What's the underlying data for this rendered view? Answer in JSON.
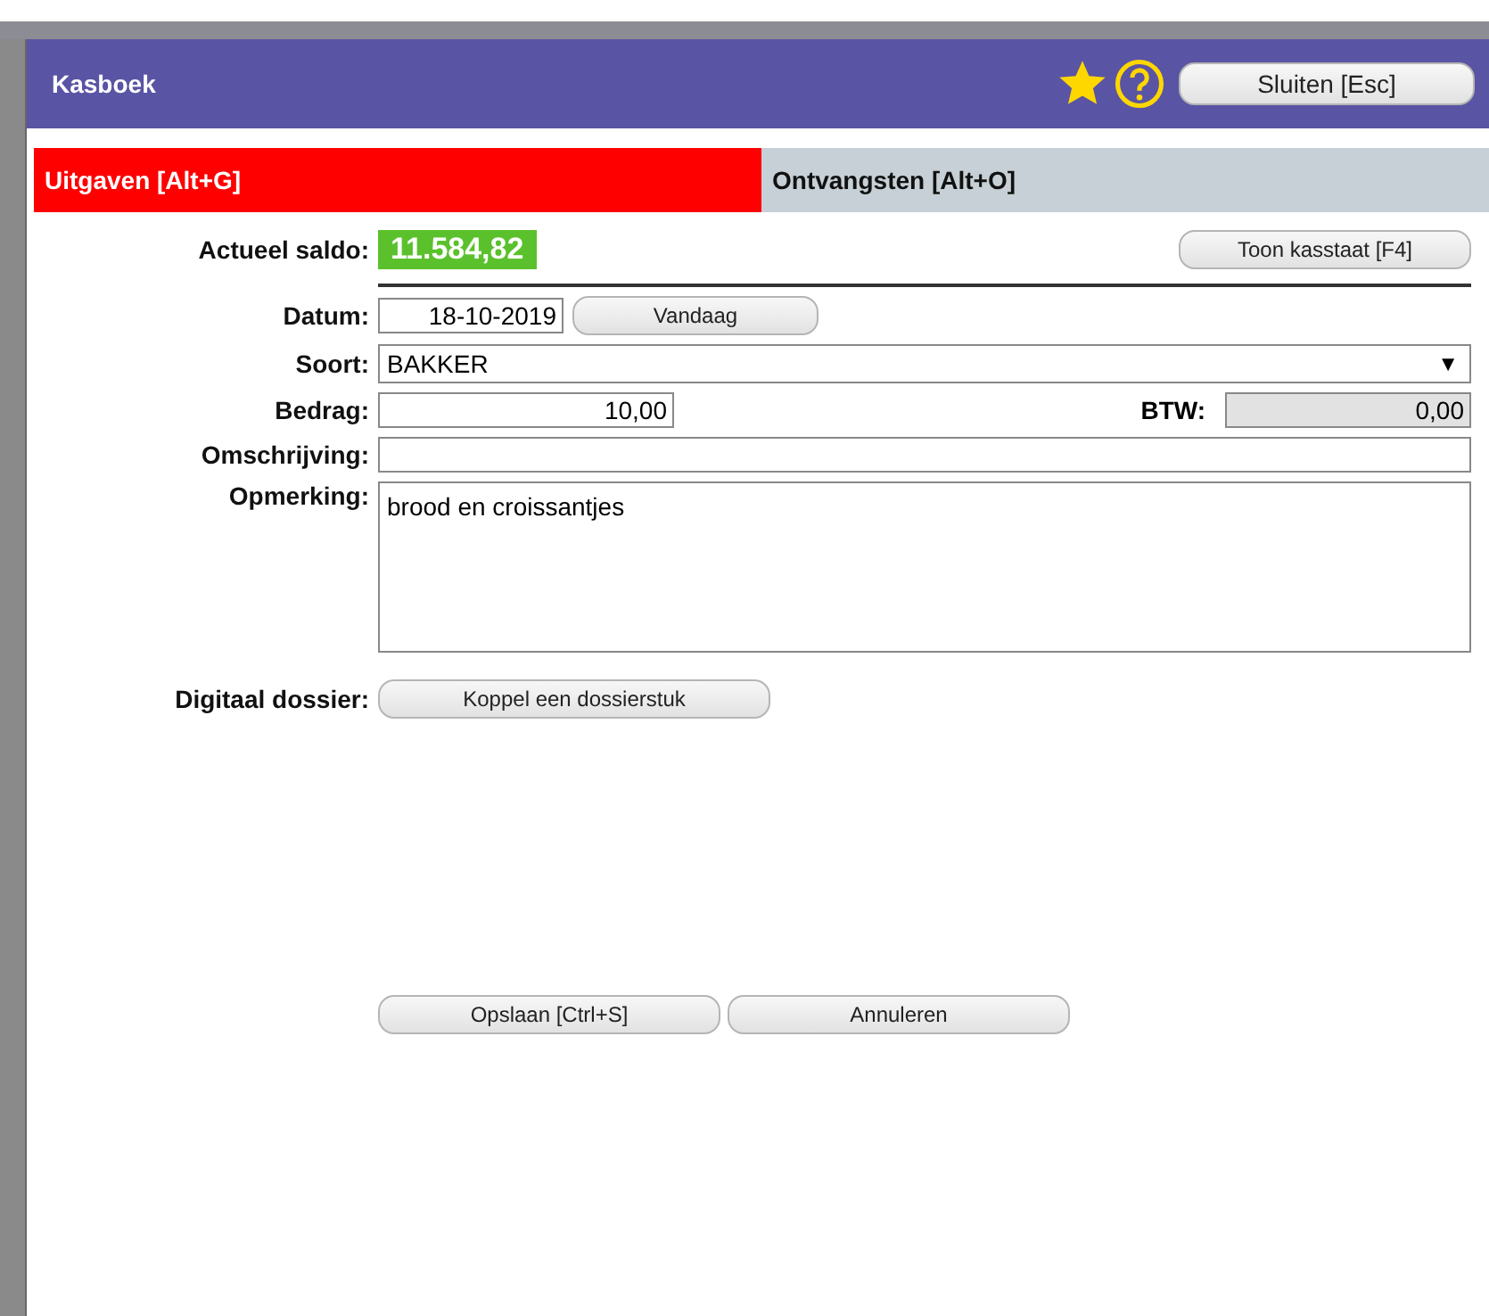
{
  "window": {
    "title": "Kasboek",
    "favorite": true,
    "close_button": "Sluiten [Esc]"
  },
  "tabs": [
    {
      "label": "Uitgaven [Alt+G]",
      "selected": true
    },
    {
      "label": "Ontvangsten [Alt+O]",
      "selected": false
    }
  ],
  "balance": {
    "label": "Actueel saldo:",
    "value": "11.584,82",
    "button": "Toon kasstaat [F4]"
  },
  "form": {
    "date_label": "Datum:",
    "date": "18-10-2019",
    "today_button": "Vandaag",
    "type_label": "Soort:",
    "type": "BAKKER",
    "type_arrow": "▼",
    "amount_label": "Bedrag:",
    "amount": "10,00",
    "vat_label": "BTW:",
    "vat": "0,00",
    "description_label": "Omschrijving:",
    "remark_label": "Opmerking:",
    "remark": "brood en croissantjes",
    "dossier_label": "Digitaal dossier:",
    "dossier_button": "Koppel een dossierstuk"
  },
  "buttons": [
    "Opslaan [Ctrl+S]",
    "Annuleren"
  ]
}
